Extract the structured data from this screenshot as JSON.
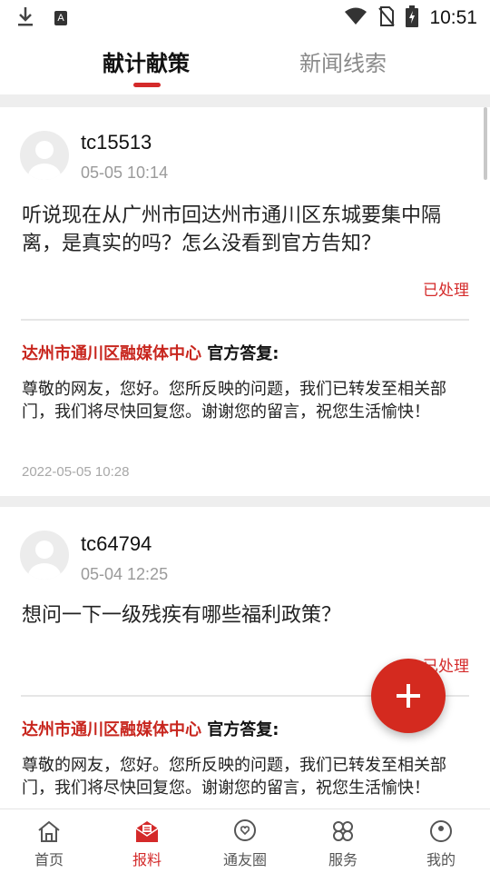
{
  "statusbar": {
    "time": "10:51"
  },
  "tabs": [
    {
      "label": "献计献策",
      "active": true
    },
    {
      "label": "新闻线索",
      "active": false
    }
  ],
  "posts": [
    {
      "username": "tc15513",
      "time": "05-05  10:14",
      "question": "听说现在从广州市回达州市通川区东城要集中隔离，是真实的吗？怎么没看到官方告知？",
      "status": "已处理",
      "reply_org": "达州市通川区融媒体中心",
      "reply_label": " 官方答复:",
      "reply_body": "尊敬的网友，您好。您所反映的问题，我们已转发至相关部门，我们将尽快回复您。谢谢您的留言，祝您生活愉快！",
      "reply_time": "2022-05-05 10:28"
    },
    {
      "username": "tc64794",
      "time": "05-04  12:25",
      "question": "想问一下一级残疾有哪些福利政策？",
      "status": "已处理",
      "reply_org": "达州市通川区融媒体中心",
      "reply_label": " 官方答复:",
      "reply_body": "尊敬的网友，您好。您所反映的问题，我们已转发至相关部门，我们将尽快回复您。谢谢您的留言，祝您生活愉快！"
    }
  ],
  "bottom_nav": [
    {
      "label": "首页",
      "icon": "home-icon",
      "active": false
    },
    {
      "label": "报料",
      "icon": "report-envelope-icon",
      "active": true
    },
    {
      "label": "通友圈",
      "icon": "chat-bubble-icon",
      "active": false
    },
    {
      "label": "服务",
      "icon": "service-grid-icon",
      "active": false
    },
    {
      "label": "我的",
      "icon": "profile-icon",
      "active": false
    }
  ],
  "colors": {
    "accent": "#d42a2a",
    "org": "#c8261e"
  }
}
